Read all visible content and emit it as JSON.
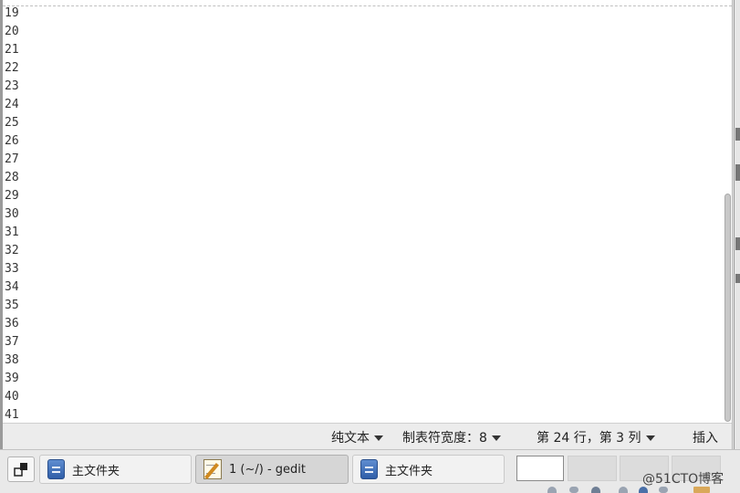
{
  "editor": {
    "line_numbers": [
      "19",
      "20",
      "21",
      "22",
      "23",
      "24",
      "25",
      "26",
      "27",
      "28",
      "29",
      "30",
      "31",
      "32",
      "33",
      "34",
      "35",
      "36",
      "37",
      "38",
      "39",
      "40",
      "41"
    ],
    "scroll_fraction": 0.55
  },
  "statusbar": {
    "language": "纯文本",
    "tab_width": "制表符宽度：8",
    "cursor_position": "第 24 行，第 3 列",
    "insert_mode": "插入"
  },
  "taskbar": {
    "tasks": [
      {
        "label": "主文件夹",
        "icon": "folder-icon"
      },
      {
        "label": "1 (~/) - gedit",
        "icon": "gedit-icon",
        "active": true
      },
      {
        "label": "主文件夹",
        "icon": "folder-icon"
      }
    ],
    "workspaces": [
      "1",
      "2",
      "3",
      "4"
    ],
    "current_workspace": "1"
  },
  "watermark": "@51CTO博客"
}
